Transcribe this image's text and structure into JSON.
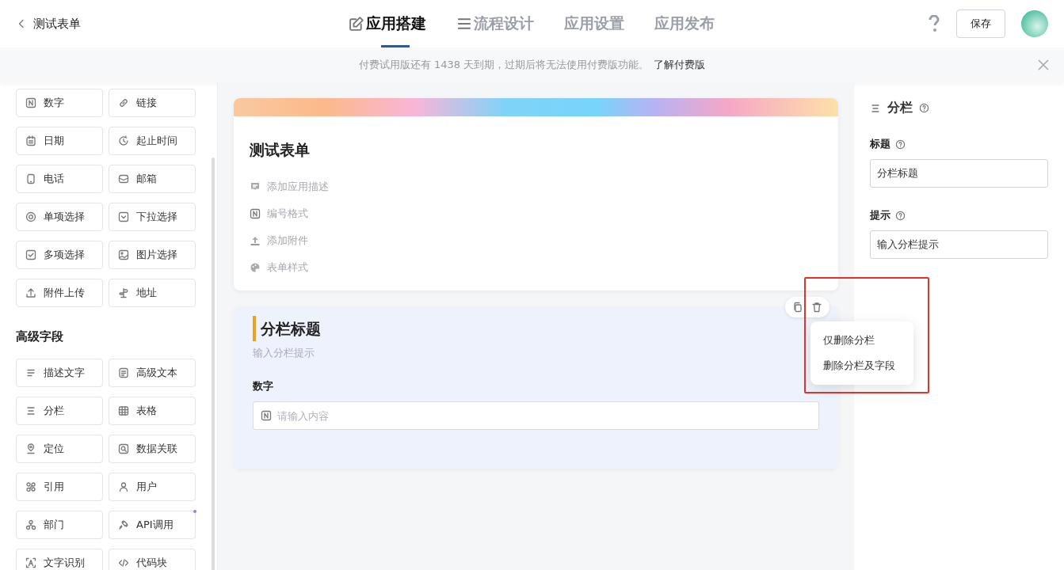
{
  "header": {
    "back_label": "测试表单",
    "tabs": [
      {
        "label": "应用搭建",
        "selected": true
      },
      {
        "label": "流程设计",
        "selected": false
      },
      {
        "label": "应用设置",
        "selected": false
      },
      {
        "label": "应用发布",
        "selected": false
      }
    ],
    "save_button": "保存"
  },
  "notice": {
    "text": "付费试用版还有 1438 天到期，过期后将无法使用付费版功能。",
    "link": "了解付费版"
  },
  "palette": {
    "basic_fields": [
      {
        "label": "数字"
      },
      {
        "label": "链接"
      },
      {
        "label": "日期"
      },
      {
        "label": "起止时间"
      },
      {
        "label": "电话"
      },
      {
        "label": "邮箱"
      },
      {
        "label": "单项选择"
      },
      {
        "label": "下拉选择"
      },
      {
        "label": "多项选择"
      },
      {
        "label": "图片选择"
      },
      {
        "label": "附件上传"
      },
      {
        "label": "地址"
      }
    ],
    "advanced_title": "高级字段",
    "advanced_fields": [
      {
        "label": "描述文字",
        "new": false
      },
      {
        "label": "高级文本",
        "new": false
      },
      {
        "label": "分栏",
        "new": false
      },
      {
        "label": "表格",
        "new": false
      },
      {
        "label": "定位",
        "new": false
      },
      {
        "label": "数据关联",
        "new": false
      },
      {
        "label": "引用",
        "new": false
      },
      {
        "label": "用户",
        "new": false
      },
      {
        "label": "部门",
        "new": false
      },
      {
        "label": "API调用",
        "new": true
      },
      {
        "label": "文字识别",
        "new": false
      },
      {
        "label": "代码块",
        "new": false
      }
    ]
  },
  "form": {
    "title": "测试表单",
    "actions": [
      "添加应用描述",
      "编号格式",
      "添加附件",
      "表单样式"
    ]
  },
  "section": {
    "title": "分栏标题",
    "hint": "输入分栏提示",
    "field": {
      "label": "数字",
      "placeholder": "请输入内容"
    }
  },
  "delete_menu": [
    "仅删除分栏",
    "删除分栏及字段"
  ],
  "properties": {
    "title": "分栏",
    "fields": [
      {
        "label": "标题",
        "value": "分栏标题"
      },
      {
        "label": "提示",
        "value": "输入分栏提示"
      }
    ]
  }
}
